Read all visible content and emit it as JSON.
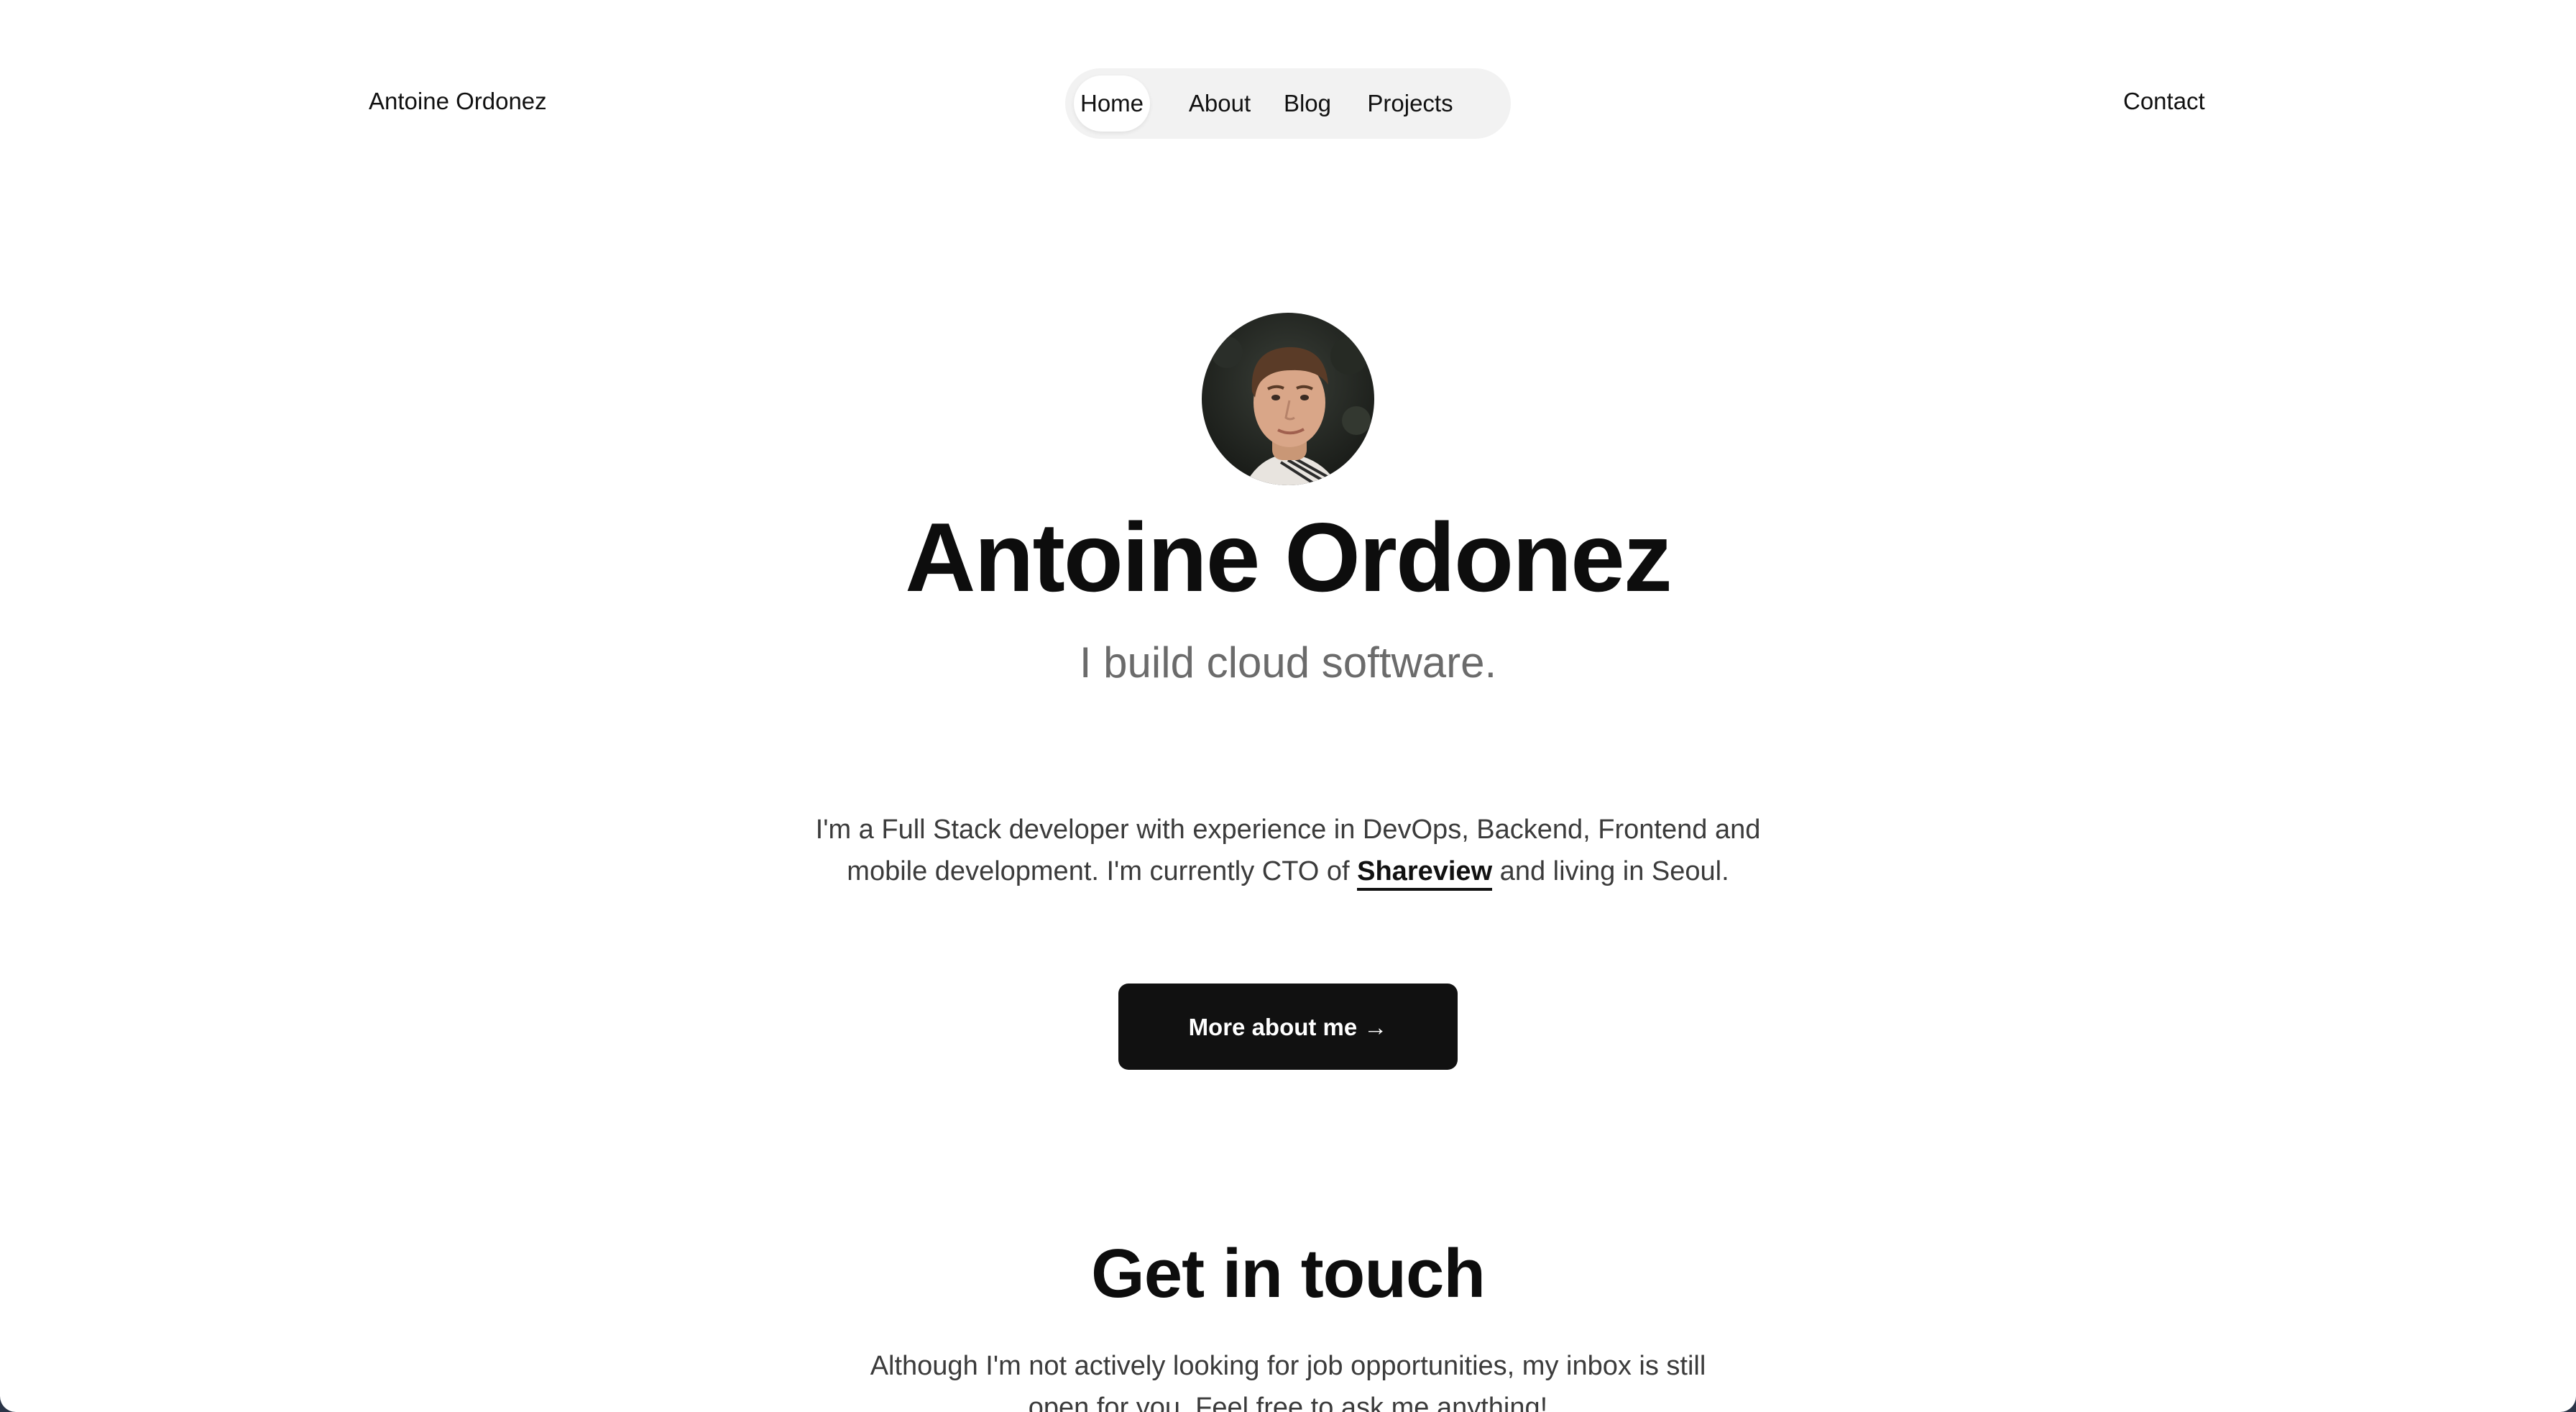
{
  "header": {
    "brand": "Antoine Ordonez",
    "nav": [
      {
        "label": "Home",
        "active": true
      },
      {
        "label": "About",
        "active": false
      },
      {
        "label": "Blog",
        "active": false
      },
      {
        "label": "Projects",
        "active": false
      }
    ],
    "contact": "Contact"
  },
  "hero": {
    "name": "Antoine Ordonez",
    "tagline": "I build cloud software.",
    "bio_line1": "I'm a Full Stack developer with experience in DevOps, Backend, Frontend and",
    "bio_line2_before": "mobile development. I'm currently CTO of ",
    "bio_company": "Shareview",
    "bio_line2_after": " and living in Seoul.",
    "cta": "More about me →"
  },
  "contact_section": {
    "heading": "Get in touch",
    "text_line1": "Although I'm not actively looking for job opportunities, my inbox is still",
    "text_line2": "open for you. Feel free to ask me anything!"
  },
  "colors": {
    "page_background": "#ffffff",
    "text_primary": "#111111",
    "text_muted": "#6b6b6b",
    "nav_pill": "#f2f2f2",
    "button_background": "#111111"
  }
}
